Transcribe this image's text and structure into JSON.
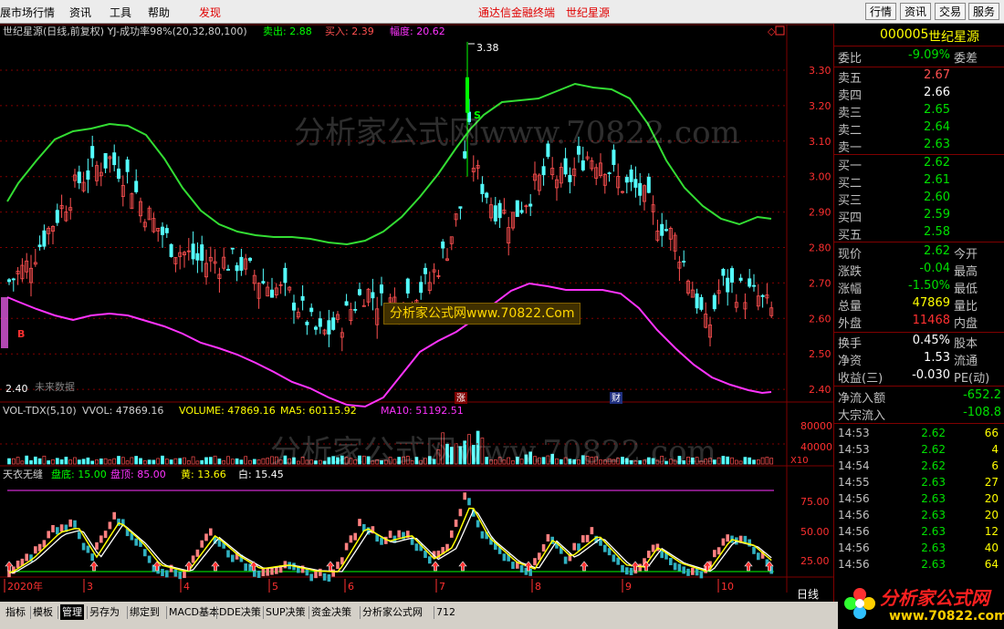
{
  "menu": {
    "items": [
      "展市场行情",
      "资讯",
      "工具",
      "帮助",
      "发现"
    ],
    "center_links": [
      "通达信金融终端",
      "世纪星源"
    ],
    "buttons": [
      "行情",
      "资讯",
      "交易",
      "服务"
    ]
  },
  "main_chart": {
    "title": "世纪星源(日线,前复权) YJ-成功率98%(20,32,80,100)",
    "sell_label": "卖出: 2.88",
    "buy_label": "买入: 2.39",
    "amp_label": "幅度: 20.62",
    "high_label": "3.38",
    "low_label": "2.40",
    "s_mark": "S",
    "b_mark": "B",
    "future_text": "未来数据",
    "event_zhang": "涨",
    "event_cai": "财",
    "y_ticks": [
      "3.30",
      "3.20",
      "3.10",
      "3.00",
      "2.90",
      "2.80",
      "2.70",
      "2.60",
      "2.50",
      "2.40"
    ],
    "watermark": "分析家公式网www.70822.com",
    "banner": "分析家公式网www.70822.Com"
  },
  "vol_chart": {
    "title": "VOL-TDX(5,10)",
    "vvol": "VVOL: 47869.16",
    "volume": "VOLUME: 47869.16",
    "ma5": "MA5: 60115.92",
    "ma10": "MA10: 51192.51",
    "y_ticks": [
      "80000",
      "40000"
    ],
    "unit": "X10",
    "watermark": "分析家公式网www.70822.com"
  },
  "osc_chart": {
    "title": "天衣无缝",
    "bottom": "盘底: 15.00",
    "top": "盘顶: 85.00",
    "yellow": "黄: 13.66",
    "white": "白: 15.45",
    "y_ticks": [
      "75.00",
      "50.00",
      "25.00"
    ]
  },
  "x_axis": {
    "labels": [
      "2020年",
      "3",
      "4",
      "5",
      "6",
      "7",
      "8",
      "9",
      "10"
    ],
    "period": "日线"
  },
  "quote": {
    "code": "000005",
    "name": "世纪星源",
    "weibi_label": "委比",
    "weibi_value": "-9.09%",
    "weicha_label": "委差",
    "asks": [
      {
        "label": "卖五",
        "price": "2.67"
      },
      {
        "label": "卖四",
        "price": "2.66"
      },
      {
        "label": "卖三",
        "price": "2.65"
      },
      {
        "label": "卖二",
        "price": "2.64"
      },
      {
        "label": "卖一",
        "price": "2.63"
      }
    ],
    "bids": [
      {
        "label": "买一",
        "price": "2.62"
      },
      {
        "label": "买二",
        "price": "2.61"
      },
      {
        "label": "买三",
        "price": "2.60"
      },
      {
        "label": "买四",
        "price": "2.59"
      },
      {
        "label": "买五",
        "price": "2.58"
      }
    ],
    "stats": [
      {
        "label": "现价",
        "value": "2.62",
        "label2": "今开"
      },
      {
        "label": "涨跌",
        "value": "-0.04",
        "label2": "最高"
      },
      {
        "label": "涨幅",
        "value": "-1.50%",
        "label2": "最低"
      },
      {
        "label": "总量",
        "value": "47869",
        "label2": "量比"
      },
      {
        "label": "外盘",
        "value": "11468",
        "label2": "内盘"
      }
    ],
    "stats2": [
      {
        "label": "换手",
        "value": "0.45%",
        "label2": "股本"
      },
      {
        "label": "净资",
        "value": "1.53",
        "label2": "流通"
      },
      {
        "label": "收益(三)",
        "value": "-0.030",
        "label2": "PE(动)"
      }
    ],
    "flow": [
      {
        "label": "净流入额",
        "value": "-652.2"
      },
      {
        "label": "大宗流入",
        "value": "-108.8"
      }
    ]
  },
  "trades": [
    {
      "time": "14:53",
      "price": "2.62",
      "vol": "66"
    },
    {
      "time": "14:53",
      "price": "2.62",
      "vol": "4"
    },
    {
      "time": "14:54",
      "price": "2.62",
      "vol": "6"
    },
    {
      "time": "14:55",
      "price": "2.63",
      "vol": "27"
    },
    {
      "time": "14:56",
      "price": "2.63",
      "vol": "20"
    },
    {
      "time": "14:56",
      "price": "2.63",
      "vol": "20"
    },
    {
      "time": "14:56",
      "price": "2.63",
      "vol": "12"
    },
    {
      "time": "14:56",
      "price": "2.63",
      "vol": "40"
    },
    {
      "time": "14:56",
      "price": "2.63",
      "vol": "64"
    }
  ],
  "tabs": [
    "指标",
    "模板",
    "管理",
    "另存为",
    "绑定到",
    "MACD基本",
    "DDE决策",
    "SUP决策",
    "资金决策",
    "分析家公式网",
    "712"
  ],
  "logo": {
    "text": "分析家公式网",
    "url": "www.70822.com"
  },
  "colors": {
    "up": "#ff5050",
    "down": "#54ffff",
    "green_band": "#33dd33",
    "magenta_band": "#ff33ff",
    "yellow": "#ffff00"
  }
}
